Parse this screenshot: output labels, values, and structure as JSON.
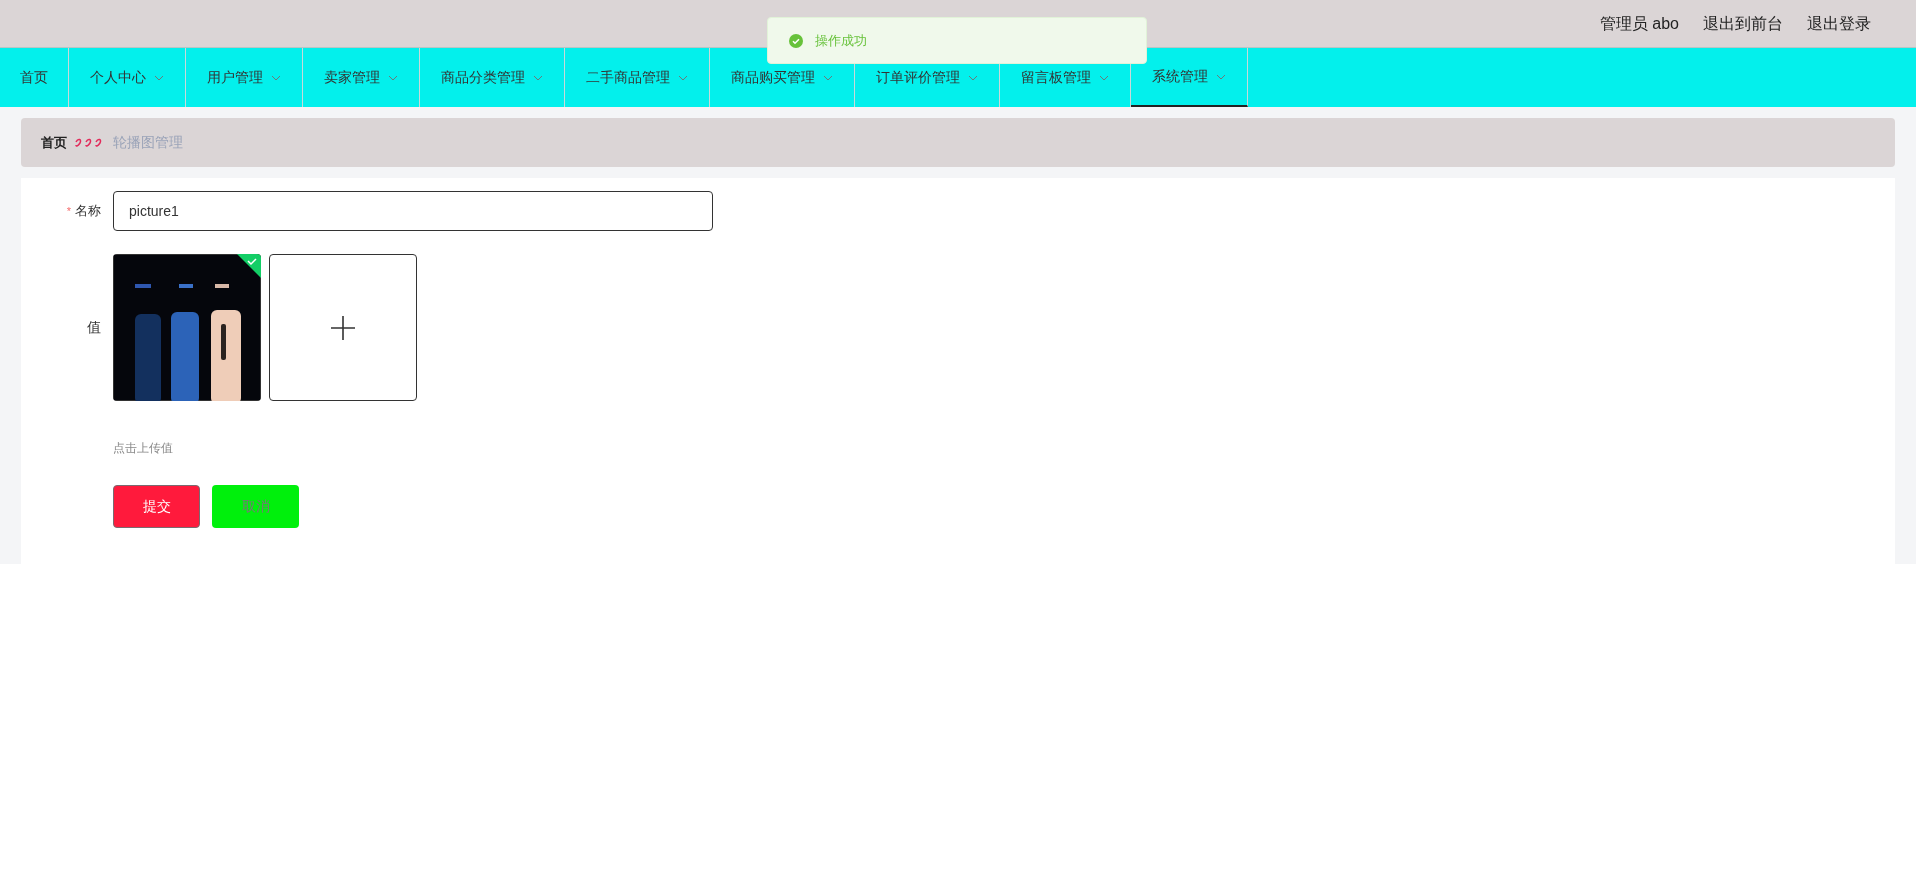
{
  "header": {
    "user": "管理员 abo",
    "links": [
      "退出到前台",
      "退出登录"
    ]
  },
  "toast": {
    "message": "操作成功"
  },
  "nav": [
    {
      "label": "首页",
      "dropdown": false,
      "selected": false
    },
    {
      "label": "个人中心",
      "dropdown": true,
      "selected": false
    },
    {
      "label": "用户管理",
      "dropdown": true,
      "selected": false
    },
    {
      "label": "卖家管理",
      "dropdown": true,
      "selected": false
    },
    {
      "label": "商品分类管理",
      "dropdown": true,
      "selected": false
    },
    {
      "label": "二手商品管理",
      "dropdown": true,
      "selected": false
    },
    {
      "label": "商品购买管理",
      "dropdown": true,
      "selected": false
    },
    {
      "label": "订单评价管理",
      "dropdown": true,
      "selected": false
    },
    {
      "label": "留言板管理",
      "dropdown": true,
      "selected": false
    },
    {
      "label": "系统管理",
      "dropdown": true,
      "selected": true
    }
  ],
  "breadcrumb": [
    "首页",
    "轮播图管理"
  ],
  "form": {
    "name": {
      "label": "名称",
      "required": true,
      "required_mark": "*",
      "value": "picture1"
    },
    "value": {
      "label": "值",
      "uploaded": true,
      "hint": "点击上传值"
    },
    "buttons": [
      {
        "label": "提交",
        "kind": "submit"
      },
      {
        "label": "取消",
        "kind": "cancel"
      }
    ]
  }
}
